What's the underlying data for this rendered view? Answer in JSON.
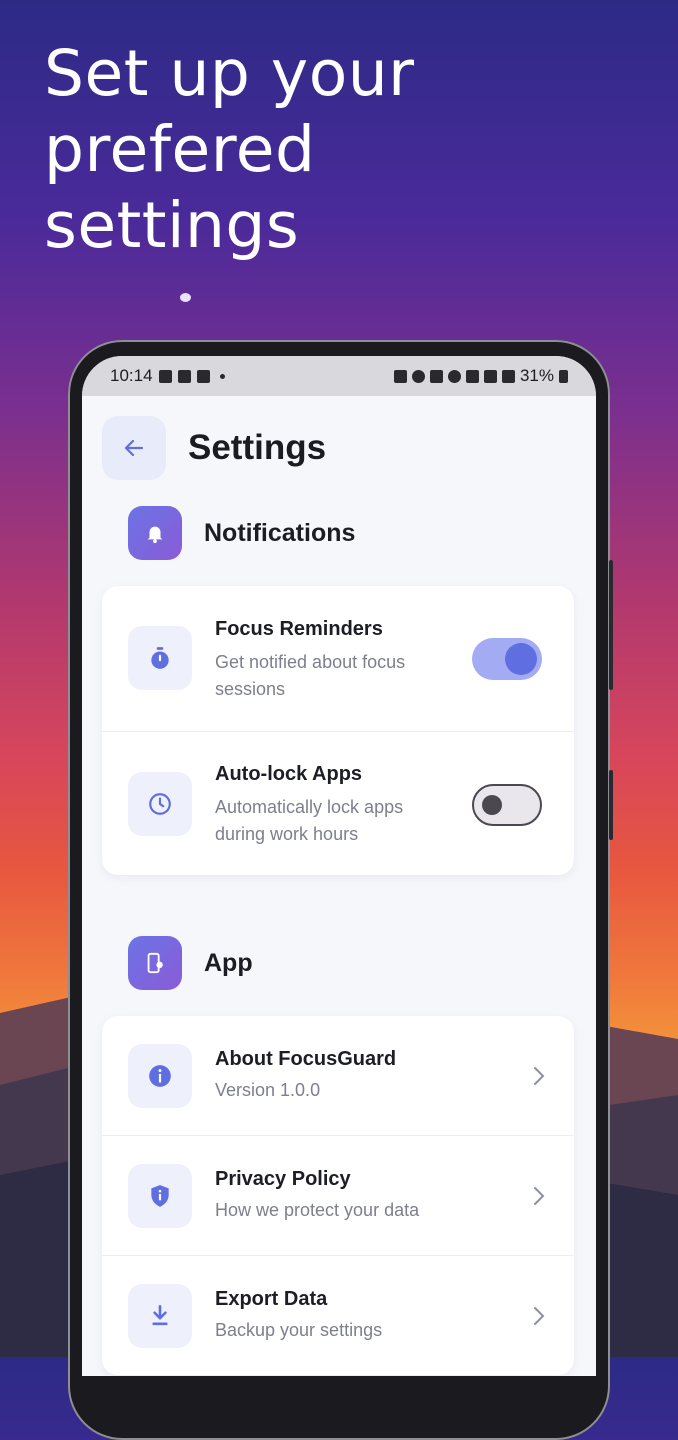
{
  "headline": {
    "line1": "Set up your prefered",
    "line2": "settings"
  },
  "statusbar": {
    "time": "10:14",
    "battery": "31%"
  },
  "appbar": {
    "title": "Settings"
  },
  "notifications": {
    "title": "Notifications",
    "items": [
      {
        "title": "Focus Reminders",
        "subtitle_line1": "Get notified about focus",
        "subtitle_line2": "sessions",
        "toggle": "on"
      },
      {
        "title": "Auto-lock Apps",
        "subtitle_line1": "Automatically lock apps",
        "subtitle_line2": "during work hours",
        "toggle": "off"
      }
    ]
  },
  "app": {
    "title": "App",
    "items": [
      {
        "title": "About FocusGuard",
        "subtitle": "Version 1.0.0"
      },
      {
        "title": "Privacy Policy",
        "subtitle": "How we protect your data"
      },
      {
        "title": "Export Data",
        "subtitle": "Backup your settings"
      }
    ]
  },
  "colors": {
    "accent": "#5f6ee0",
    "toggle_track_on": "#a3acf2",
    "icon_bg": "#eef0fb"
  }
}
